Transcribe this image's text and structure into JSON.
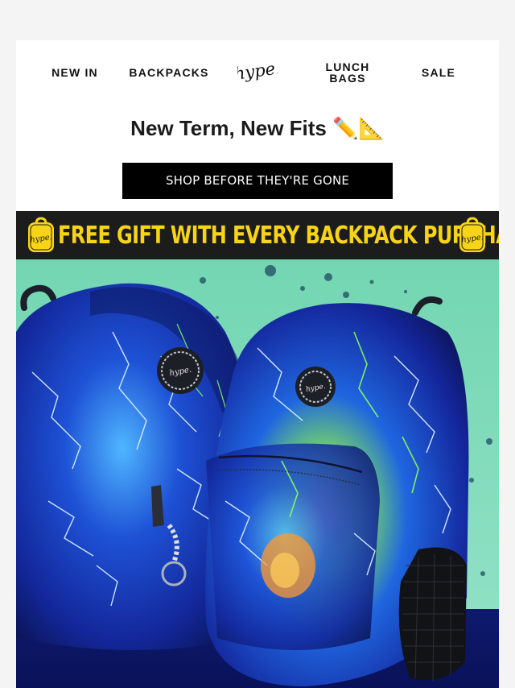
{
  "nav": {
    "new_in": "NEW IN",
    "backpacks": "BACKPACKS",
    "logo_text": "hype.",
    "lunch_line1": "LUNCH",
    "lunch_line2": "BAGS",
    "sale": "SALE"
  },
  "headline": "New Term, New Fits ✏️📐",
  "cta": {
    "label": "SHOP BEFORE THEY'RE GONE"
  },
  "promo": {
    "text": "FREE GIFT WITH EVERY BACKPACK PURCHASE!",
    "bag_logo_text": "hype.",
    "icon": "backpack-icon"
  },
  "hero": {
    "description_icon": "lightning-backpacks-image"
  },
  "colors": {
    "promo_yellow": "#f7d417",
    "promo_background": "#1c1c1c",
    "hero_mint": "#79d7b3",
    "hero_navy": "#0c1668",
    "button_black": "#000000"
  }
}
